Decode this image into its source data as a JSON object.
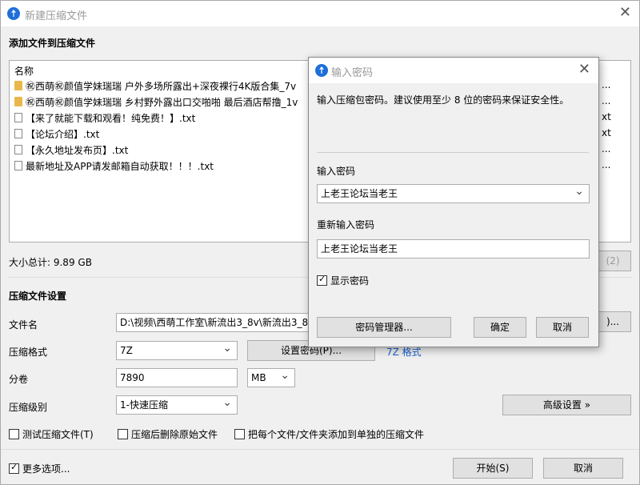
{
  "main": {
    "title": "新建压缩文件",
    "add_section": "添加文件到压缩文件",
    "list_header": "名称",
    "files": [
      {
        "name": "㊗西萌㊗颜值学妹瑞瑞 户外多场所露出+深夜裸行4K版合集_7v",
        "type": "folder",
        "icon": "folder-icon"
      },
      {
        "name": "㊗西萌㊗颜值学妹瑞瑞 乡村野外露出口交啪啪 最后酒店帮撸_1v",
        "type": "folder",
        "icon": "folder-icon"
      },
      {
        "name": "【来了就能下载和观看！纯免费！】.txt",
        "type": "file",
        "icon": "file-icon"
      },
      {
        "name": "【论坛介绍】.txt",
        "type": "file",
        "icon": "file-icon"
      },
      {
        "name": "【永久地址发布页】.txt",
        "type": "file",
        "icon": "file-icon"
      },
      {
        "name": "最新地址及APP请发邮箱自动获取！！！.txt",
        "type": "file",
        "icon": "file-icon"
      }
    ],
    "right_col_fragments": [
      "...",
      "...",
      "xt",
      "xt",
      "...",
      "..."
    ],
    "total_size": "大小总计: 9.89 GB",
    "hidden_btn_fragment": "(2)",
    "settings_section": "压缩文件设置",
    "filename_label": "文件名",
    "filename_value": "D:\\视频\\西萌工作室\\新流出3_8v\\新流出3_8",
    "browse_fragment": ")...",
    "format_label": "压缩格式",
    "format_value": "7Z",
    "set_password_button": "设置密码(P)...",
    "format_link": "7Z 格式",
    "split_label": "分卷",
    "split_value": "7890",
    "split_unit": "MB",
    "level_label": "压缩级别",
    "level_value": "1-快速压缩",
    "advanced_button": "高级设置 »",
    "test_archive": "测试压缩文件(T)",
    "delete_after": "压缩后删除原始文件",
    "separate_archives": "把每个文件/文件夹添加到单独的压缩文件",
    "more_options": "更多选项...",
    "start_button": "开始(S)",
    "cancel_button": "取消"
  },
  "dialog": {
    "title": "输入密码",
    "hint": "输入压缩包密码。建议使用至少 8 位的密码来保证安全性。",
    "password_label": "输入密码",
    "password_value": "上老王论坛当老王",
    "confirm_label": "重新输入密码",
    "confirm_value": "上老王论坛当老王",
    "show_password": "显示密码",
    "show_password_checked": true,
    "manager_button": "密码管理器...",
    "ok_button": "确定",
    "cancel_button": "取消"
  },
  "colors": {
    "accent": "#1e6fd9",
    "link": "#1a5fd0",
    "folder": "#e8b84a"
  }
}
